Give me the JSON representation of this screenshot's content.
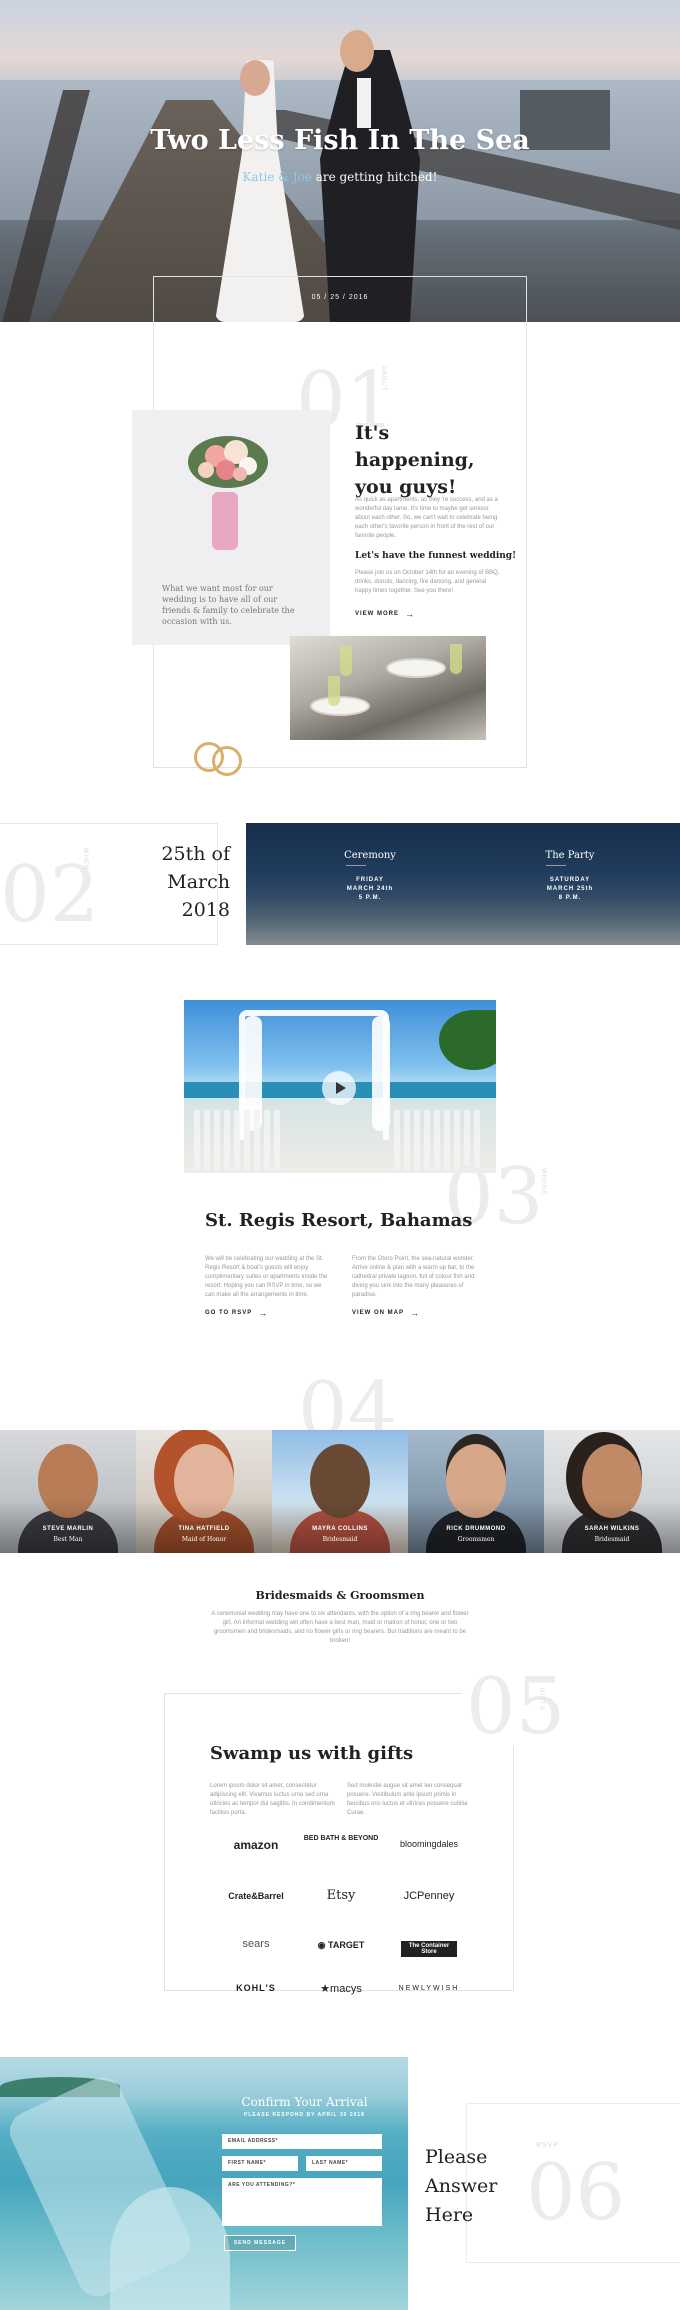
{
  "hero": {
    "title": "Two Less Fish In The Sea",
    "subtitle_names": "Katie & Joe",
    "subtitle_rest": " are getting hitched!",
    "date": "05 / 25 / 2016"
  },
  "section1": {
    "number": "01",
    "label": "ABOUT",
    "title": "It's happening, you guys!",
    "paragraph1": "As quick as apartments, as they 're success, and as a wonderful day tame. It's time to maybe get serious about each other. So, we can't wait to celebrate being each other's favorite person in front of the rest of our favorite people.",
    "subheading": "Let's have the funnest wedding!",
    "paragraph2": "Please join us on October 14th for an evening of BBQ, drinks, donuts, dancing, fire dancing, and general happy times together. See you there!",
    "view_more": "VIEW MORE",
    "quote": "What we want most for our wedding is to have all of our friends & family to celebrate the occasion with us."
  },
  "section2": {
    "number": "02",
    "label": "WHEN",
    "date_line1": "25th of",
    "date_line2": "March",
    "date_line3": "2018",
    "events": [
      {
        "title": "Ceremony",
        "day": "FRIDAY",
        "date": "MARCH 24th",
        "time": "5 P.M."
      },
      {
        "title": "The Party",
        "day": "SATURDAY",
        "date": "MARCH 25th",
        "time": "8 P.M."
      }
    ]
  },
  "section3": {
    "number": "03",
    "label": "WHERE",
    "title": "St. Regis Resort, Bahamas",
    "paragraph1": "We will be celebrating our wedding at the St. Regis Resort & boat's guests will enjoy complimentary suites or apartments inside the resort. Hoping you can RSVP in time, so we can make all the arrangements in time.",
    "paragraph2": "From the Otoro Point, the sea-natural wonder. Arrive online & plan with a warm up bar, to the cathedral private lagoon, full of colour fish and diving you sink into the many pleasures of paradise.",
    "rsvp_link": "GO TO RSVP",
    "map_link": "VIEW ON MAP"
  },
  "section4": {
    "number": "04",
    "people": [
      {
        "name": "STEVE MARLIN",
        "role": "Best Man"
      },
      {
        "name": "TINA HATFIELD",
        "role": "Maid of Honor"
      },
      {
        "name": "MAYRA COLLINS",
        "role": "Bridesmaid"
      },
      {
        "name": "RICK DRUMMOND",
        "role": "Groomsmen"
      },
      {
        "name": "SARAH WILKINS",
        "role": "Bridesmaid"
      }
    ],
    "title": "Bridesmaids & Groomsmen",
    "paragraph": "A ceremonial wedding may have one to six attendants, with the option of a ring bearer and flower girl. An informal wedding will often have a best man, maid or matron of honor, one or two groomsmen and bridesmaids, and no flower girls or ring bearers. But traditions are meant to be broken!"
  },
  "section5": {
    "number": "05",
    "label": "GIFTS",
    "title": "Swamp us with gifts",
    "paragraph1": "Lorem ipsum dolor sit amet, consectetur adipiscing elit. Vivamus luctus urna sed urna ultricies ac tempor dui sagittis. In condimentum facilisis porta.",
    "paragraph2": "Sed molestie augue sit amet leo consequat posuere. Vestibulum ante ipsum primis in faucibus orci luctus et ultrices posuere cubilia Curae.",
    "logos": [
      "amazon",
      "BED BATH & BEYOND",
      "bloomingdales",
      "Crate&Barrel",
      "Etsy",
      "JCPenney",
      "sears",
      "TARGET",
      "The Container Store",
      "KOHL'S",
      "macys",
      "NEWLYWISH"
    ]
  },
  "section6": {
    "number": "06",
    "label": "RSVP",
    "form_title": "Confirm Your Arrival",
    "form_subtitle": "PLEASE RESPOND BY APRIL 30 2018",
    "email_placeholder": "EMAIL ADDRESS*",
    "first_name_placeholder": "FIRST NAME*",
    "last_name_placeholder": "LAST NAME*",
    "attending_placeholder": "ARE YOU ATTENDING?*",
    "send_label": "SEND MESSAGE",
    "answer_line1": "Please",
    "answer_line2": "Answer",
    "answer_line3": "Here"
  },
  "colors": {
    "accent_blue": "#8ec6ea",
    "ring_gold": "#d8b06a",
    "card_gray": "#efeff2"
  }
}
